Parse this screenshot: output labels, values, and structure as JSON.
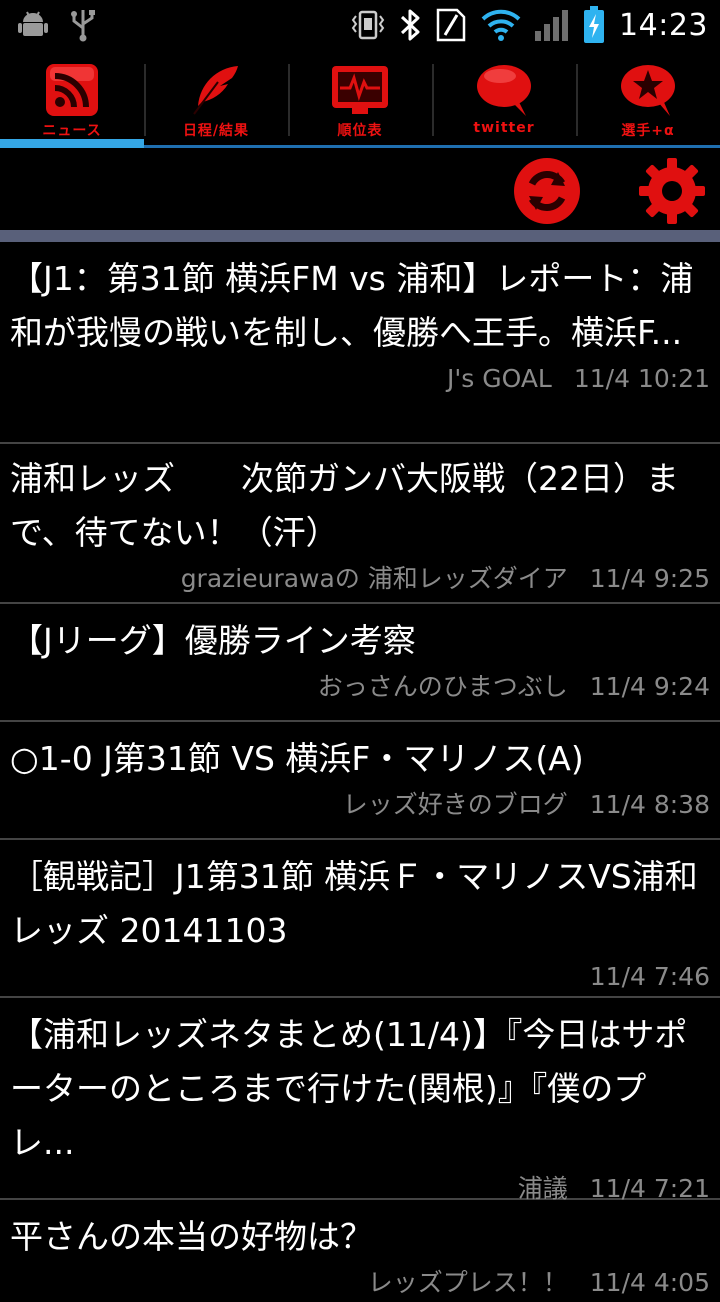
{
  "status_bar": {
    "time": "14:23",
    "icons": [
      "android-debug-icon",
      "usb-icon",
      "vibrate-icon",
      "bluetooth-icon",
      "nfc-sim-icon",
      "wifi-icon",
      "signal-icon",
      "battery-charging-icon"
    ]
  },
  "tabs": [
    {
      "label": "ニュース",
      "icon": "rss-icon",
      "active": true
    },
    {
      "label": "日程/結果",
      "icon": "feather-icon",
      "active": false
    },
    {
      "label": "順位表",
      "icon": "monitor-pulse-icon",
      "active": false
    },
    {
      "label": "twitter",
      "icon": "speech-bubble-icon",
      "active": false
    },
    {
      "label": "選手+α",
      "icon": "star-bubble-icon",
      "active": false
    }
  ],
  "actions": {
    "refresh_icon": "refresh-icon",
    "settings_icon": "gear-icon"
  },
  "colors": {
    "accent_red": "#e01010",
    "tab_active_underline": "#35a7e6",
    "tab_underline": "#1f6fb0",
    "separator": "#59607a",
    "meta_text": "#8a8a8a"
  },
  "news": [
    {
      "title": "【J1：第31節 横浜FM vs 浦和】レポート：浦和が我慢の戦いを制し、優勝へ王手。横浜F...",
      "source": "J's GOAL",
      "time": "11/4 10:21"
    },
    {
      "title": "浦和レッズ　　次節ガンバ大阪戦（22日）まで、待てない！（汗）",
      "source": "grazieurawaの 浦和レッズダイア",
      "time": "11/4 9:25"
    },
    {
      "title": "【Jリーグ】優勝ライン考察",
      "source": "おっさんのひまつぶし",
      "time": "11/4 9:24"
    },
    {
      "title": "○1-0 J第31節 VS 横浜F・マリノス(A)",
      "source": "レッズ好きのブログ",
      "time": "11/4 8:38"
    },
    {
      "title": "［観戦記］J1第31節 横浜Ｆ・マリノスVS浦和レッズ 20141103",
      "source": "",
      "time": "11/4 7:46"
    },
    {
      "title": "【浦和レッズネタまとめ(11/4)】『今日はサポーターのところまで行けた(関根)』『僕のプレ...",
      "source": "浦議",
      "time": "11/4 7:21"
    },
    {
      "title": "平さんの本当の好物は？",
      "source": "レッズプレス！！",
      "time": "11/4 4:05"
    }
  ]
}
